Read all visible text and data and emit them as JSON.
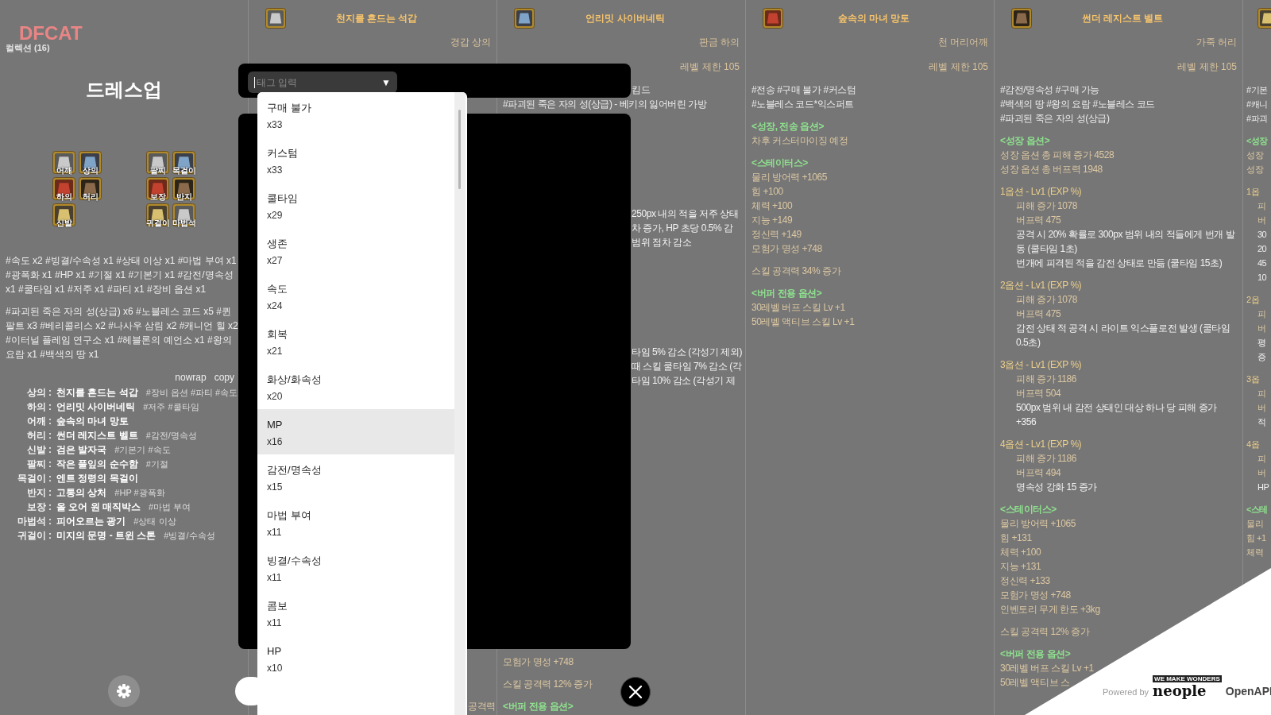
{
  "sidebar": {
    "logo": "DFCAT",
    "collection": "컬렉션 (16)",
    "title": "드레스업",
    "slot_groups": [
      [
        {
          "label": "어깨"
        },
        {
          "label": "상의"
        },
        {
          "label": "하의"
        },
        {
          "label": "허리"
        },
        {
          "label": "신발"
        }
      ],
      [
        {
          "label": "팔찌"
        },
        {
          "label": "목걸이"
        },
        {
          "label": "보장"
        },
        {
          "label": "반지"
        },
        {
          "label": "귀걸이"
        },
        {
          "label": "마법석"
        }
      ]
    ],
    "tag_summary": [
      "#속도 x2 #빙결/수속성 x1 #상태 이상 x1 #마법 부여 x1 #광폭화 x1 #HP x1 #기절 x1 #기본기 x1 #감전/명속성 x1 #쿨타임 x1 #저주 x1 #파티 x1 #장비 옵션 x1",
      "#파괴된 죽은 자의 성(상급) x6 #노블레스 코드 x5 #퀸 팔트 x3 #베리콜리스 x2 #나사우 삼림 x2 #캐니언 힐 x2 #이터널 플레임 연구소 x1 #헤블론의 예언소 x1 #왕의 요람 x1 #백색의 땅 x1"
    ],
    "actions": [
      "nowrap",
      "copy"
    ],
    "equipment": [
      {
        "slot": "상의 :",
        "name": "천지를 흔드는 석갑",
        "tags": "#장비 옵션 #파티 #속도"
      },
      {
        "slot": "하의 :",
        "name": "언리밋 사이버네틱",
        "tags": "#저주 #쿨타임"
      },
      {
        "slot": "어깨 :",
        "name": "숲속의 마녀 망토"
      },
      {
        "slot": "허리 :",
        "name": "썬더 레지스트 벨트",
        "tags": "#감전/명속성"
      },
      {
        "slot": "신발 :",
        "name": "검은 발자국",
        "tags": "#기본기 #속도"
      },
      {
        "slot": "팔찌 :",
        "name": "작은 풀잎의 순수함",
        "tags": "#기절"
      },
      {
        "slot": "목걸이 :",
        "name": "엔트 정령의 목걸이"
      },
      {
        "slot": "반지 :",
        "name": "고통의 상처",
        "tags": "#HP #광폭화"
      },
      {
        "slot": "보장 :",
        "name": "올 오어 원 매직박스",
        "tags": "#마법 부여"
      },
      {
        "slot": "마법석 :",
        "name": "피어오르는 광기",
        "tags": "#상태 이상"
      },
      {
        "slot": "귀걸이 :",
        "name": "미지의 문명 - 트윈 스톤",
        "tags": "#빙결/수속성"
      }
    ]
  },
  "columns": [
    {
      "title": "천지를 흔드는 석갑",
      "type": "경갑 상의",
      "footer": [
        {
          "lines": [
            {
              "kind": "fragment-right",
              "text": "공격력"
            }
          ]
        }
      ]
    },
    {
      "title": "언리밋 사이버네틱",
      "type": "판금 하의",
      "level": "레벨 제한 105",
      "sections": [
        {
          "lines": [
            {
              "kind": "fragment",
              "text": "킴드"
            },
            {
              "kind": "tag",
              "text": "#파괴된 죽은 자의 성(상급) - 베키의 잃어버린 가방"
            }
          ]
        },
        {
          "kind": "covered",
          "lines": [
            {
              "kind": "effect",
              "text": "250px 내의 적을 저주 상태"
            },
            {
              "kind": "effect",
              "text": "차 증가, HP 초당 0.5% 감"
            },
            {
              "kind": "effect",
              "text": "범위 점차 감소"
            }
          ]
        },
        {
          "kind": "covered",
          "lines": [
            {
              "kind": "effect",
              "text": "타임 5% 감소 (각성기 제외)"
            },
            {
              "kind": "effect",
              "text": "때 스킬 쿨타임 7% 감소 (각"
            },
            {
              "kind": "effect",
              "text": "타임 10% 감소 (각성기 제"
            }
          ]
        }
      ],
      "footer": [
        {
          "lines": [
            {
              "kind": "stat",
              "text": "모험가 명성 +748"
            }
          ]
        },
        {
          "lines": [
            {
              "kind": "stat",
              "text": "스킬 공격력 12% 증가"
            }
          ]
        },
        {
          "lines": [
            {
              "kind": "heading",
              "text": "<버퍼 전용 옵션>"
            }
          ]
        }
      ]
    },
    {
      "title": "숲속의 마녀 망토",
      "type": "천 머리어깨",
      "level": "레벨 제한 105",
      "sections": [
        {
          "lines": [
            {
              "kind": "tag",
              "text": "#전송 #구매 불가 #커스텀"
            },
            {
              "kind": "tag",
              "text": "#노블레스 코드*익스퍼트"
            }
          ]
        },
        {
          "lines": [
            {
              "kind": "heading",
              "text": "<성장, 전송 옵션>"
            },
            {
              "kind": "stat",
              "text": "차후 커스터마이징 예정"
            }
          ]
        },
        {
          "lines": [
            {
              "kind": "heading",
              "text": "<스테이터스>"
            },
            {
              "kind": "stat",
              "text": "물리 방어력 +1065"
            },
            {
              "kind": "stat",
              "text": "힘 +100"
            },
            {
              "kind": "stat",
              "text": "체력 +100"
            },
            {
              "kind": "stat",
              "text": "지능 +149"
            },
            {
              "kind": "stat",
              "text": "정신력 +149"
            },
            {
              "kind": "stat",
              "text": "모험가 명성 +748"
            }
          ]
        },
        {
          "lines": [
            {
              "kind": "stat",
              "text": "스킬 공격력 34% 증가"
            }
          ]
        },
        {
          "lines": [
            {
              "kind": "heading",
              "text": "<버퍼 전용 옵션>"
            },
            {
              "kind": "stat",
              "text": "30레벨 버프 스킬 Lv +1"
            },
            {
              "kind": "stat",
              "text": "50레벨 액티브 스킬 Lv +1"
            }
          ]
        }
      ]
    },
    {
      "title": "썬더 레지스트 벨트",
      "type": "가죽 허리",
      "level": "레벨 제한 105",
      "sections": [
        {
          "lines": [
            {
              "kind": "tag",
              "text": "#감전/명속성 #구매 가능"
            },
            {
              "kind": "tag",
              "text": "#백색의 땅 #왕의 요람 #노블레스 코드"
            },
            {
              "kind": "tag",
              "text": "#파괴된 죽은 자의 성(상급)"
            }
          ]
        },
        {
          "lines": [
            {
              "kind": "heading",
              "text": "<성장 옵션>"
            },
            {
              "kind": "stat",
              "text": "성장 옵션 총 피해 증가 4528"
            },
            {
              "kind": "stat",
              "text": "성장 옵션 총 버프력 1948"
            }
          ]
        },
        {
          "lines": [
            {
              "kind": "option",
              "text": "1옵션 - Lv1 (EXP %)"
            },
            {
              "kind": "sub",
              "text": "피해 증가 1078"
            },
            {
              "kind": "sub",
              "text": "버프력 475"
            },
            {
              "kind": "effect",
              "text": "공격 시 20% 확률로 300px 범위 내의 적들에게 번개 발동 (쿨타임 1초)"
            },
            {
              "kind": "effect",
              "text": "번개에 피격된 적을 감전 상태로 만듦 (쿨타임 15초)"
            }
          ]
        },
        {
          "lines": [
            {
              "kind": "option",
              "text": "2옵션 - Lv1 (EXP %)"
            },
            {
              "kind": "sub",
              "text": "피해 증가 1078"
            },
            {
              "kind": "sub",
              "text": "버프력 475"
            },
            {
              "kind": "effect",
              "text": "감전 상태 적 공격 시 라이트 익스플로전 발생 (쿨타임 0.5초)"
            }
          ]
        },
        {
          "lines": [
            {
              "kind": "option",
              "text": "3옵션 - Lv1 (EXP %)"
            },
            {
              "kind": "sub",
              "text": "피해 증가 1186"
            },
            {
              "kind": "sub",
              "text": "버프력 504"
            },
            {
              "kind": "effect",
              "text": "500px 범위 내 감전 상태인 대상 하나 당 피해 증가 +356"
            }
          ]
        },
        {
          "lines": [
            {
              "kind": "option",
              "text": "4옵션 - Lv1 (EXP %)"
            },
            {
              "kind": "sub",
              "text": "피해 증가 1186"
            },
            {
              "kind": "sub",
              "text": "버프력 494"
            },
            {
              "kind": "effect",
              "text": "명속성 강화 15 증가"
            }
          ]
        },
        {
          "lines": [
            {
              "kind": "heading",
              "text": "<스테이터스>"
            },
            {
              "kind": "stat",
              "text": "물리 방어력 +1065"
            },
            {
              "kind": "stat",
              "text": "힘 +131"
            },
            {
              "kind": "stat",
              "text": "체력 +100"
            },
            {
              "kind": "stat",
              "text": "지능 +131"
            },
            {
              "kind": "stat",
              "text": "정신력 +133"
            },
            {
              "kind": "stat",
              "text": "모험가 명성 +748"
            },
            {
              "kind": "stat",
              "text": "인벤토리 무게 한도 +3kg"
            }
          ]
        },
        {
          "lines": [
            {
              "kind": "stat",
              "text": "스킬 공격력 12% 증가"
            }
          ]
        },
        {
          "lines": [
            {
              "kind": "heading",
              "text": "<버퍼 전용 옵션>"
            },
            {
              "kind": "stat",
              "text": "30레벨 버프 스킬 Lv +1"
            },
            {
              "kind": "stat",
              "text": "50레벨 액티브 스"
            }
          ]
        }
      ]
    },
    {
      "kind": "cut",
      "sections": [
        {
          "lines": [
            {
              "kind": "tag",
              "text": "#기본"
            },
            {
              "kind": "tag",
              "text": "#캐니"
            },
            {
              "kind": "tag",
              "text": "#파괴"
            }
          ]
        },
        {
          "lines": [
            {
              "kind": "heading",
              "text": "<성장"
            },
            {
              "kind": "stat",
              "text": "성장"
            },
            {
              "kind": "stat",
              "text": "성장"
            }
          ]
        },
        {
          "lines": [
            {
              "kind": "option",
              "text": "1옵"
            },
            {
              "kind": "sub",
              "text": "피"
            },
            {
              "kind": "sub",
              "text": "버"
            },
            {
              "kind": "effect",
              "text": "30"
            },
            {
              "kind": "effect",
              "text": "20"
            },
            {
              "kind": "effect",
              "text": "45"
            },
            {
              "kind": "effect",
              "text": "10"
            }
          ]
        },
        {
          "lines": [
            {
              "kind": "option",
              "text": "2옵"
            },
            {
              "kind": "sub",
              "text": "피"
            },
            {
              "kind": "sub",
              "text": "버"
            },
            {
              "kind": "effect",
              "text": "평"
            },
            {
              "kind": "effect",
              "text": "증"
            }
          ]
        },
        {
          "lines": [
            {
              "kind": "option",
              "text": "3옵"
            },
            {
              "kind": "sub",
              "text": "피"
            },
            {
              "kind": "sub",
              "text": "버"
            },
            {
              "kind": "effect",
              "text": "적"
            }
          ]
        },
        {
          "lines": [
            {
              "kind": "option",
              "text": "4옵"
            },
            {
              "kind": "sub",
              "text": "피"
            },
            {
              "kind": "sub",
              "text": "버"
            },
            {
              "kind": "effect",
              "text": "HP"
            }
          ]
        },
        {
          "lines": [
            {
              "kind": "heading",
              "text": "<스테"
            },
            {
              "kind": "stat",
              "text": "물리"
            },
            {
              "kind": "stat",
              "text": "힘 +1"
            },
            {
              "kind": "stat",
              "text": "체력"
            }
          ]
        }
      ]
    }
  ],
  "tag_picker": {
    "placeholder": "태그 입력",
    "arrow": "▼",
    "options": [
      {
        "name": "구매 불가",
        "count": "x33",
        "selected": false
      },
      {
        "name": "커스텀",
        "count": "x33",
        "selected": false
      },
      {
        "name": "쿨타임",
        "count": "x29",
        "selected": false
      },
      {
        "name": "생존",
        "count": "x27",
        "selected": false
      },
      {
        "name": "속도",
        "count": "x24",
        "selected": false
      },
      {
        "name": "회복",
        "count": "x21",
        "selected": false
      },
      {
        "name": "화상/화속성",
        "count": "x20",
        "selected": false
      },
      {
        "name": "MP",
        "count": "x16",
        "selected": true
      },
      {
        "name": "감전/명속성",
        "count": "x15",
        "selected": false
      },
      {
        "name": "마법 부여",
        "count": "x11",
        "selected": false
      },
      {
        "name": "빙결/수속성",
        "count": "x11",
        "selected": false
      },
      {
        "name": "콤보",
        "count": "x11",
        "selected": false
      },
      {
        "name": "HP",
        "count": "x10",
        "selected": false
      }
    ]
  },
  "credit": {
    "powered": "Powered by",
    "tagline": "WE MAKE WONDERS",
    "brand": "neople",
    "product": "OpenAPI"
  }
}
